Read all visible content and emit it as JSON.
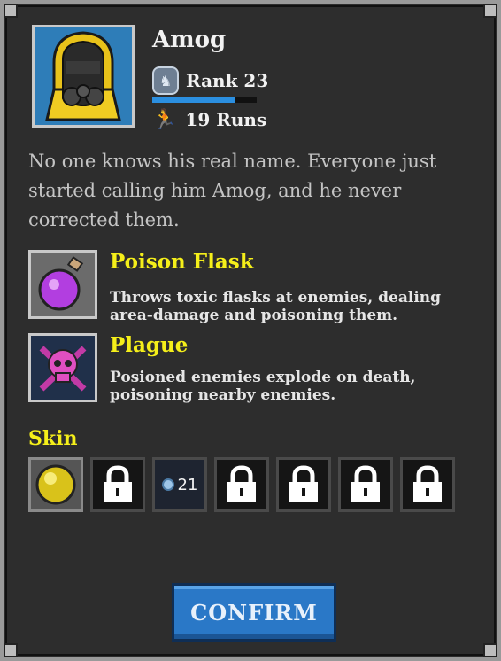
{
  "character": {
    "name": "Amog",
    "rank_label": "Rank 23",
    "rank_progress": 0.8,
    "runs_label": "19 Runs",
    "description": "No one knows his real name. Everyone just started calling him Amog, and he never corrected them."
  },
  "abilities": [
    {
      "title": "Poison Flask",
      "text": "Throws toxic flasks at enemies, dealing area-damage and poisoning them.",
      "icon": "potion-flask-icon"
    },
    {
      "title": "Plague",
      "text": "Posioned enemies explode on death, poisoning nearby enemies.",
      "icon": "skull-crossbones-icon"
    }
  ],
  "skins": {
    "title": "Skin",
    "items": [
      {
        "state": "selected",
        "icon": "yellow-orb-icon"
      },
      {
        "state": "locked",
        "icon": "lock-icon"
      },
      {
        "state": "purchasable",
        "icon": "coin-icon",
        "price": "21"
      },
      {
        "state": "locked",
        "icon": "lock-icon"
      },
      {
        "state": "locked",
        "icon": "lock-icon"
      },
      {
        "state": "locked",
        "icon": "lock-icon"
      },
      {
        "state": "locked",
        "icon": "lock-icon"
      }
    ]
  },
  "confirm_label": "CONFIRM",
  "colors": {
    "panel_bg": "#2d2d2d",
    "accent_yellow": "#f5ef1a",
    "confirm_blue": "#2a78c7",
    "xp_blue": "#2b8fe0"
  }
}
